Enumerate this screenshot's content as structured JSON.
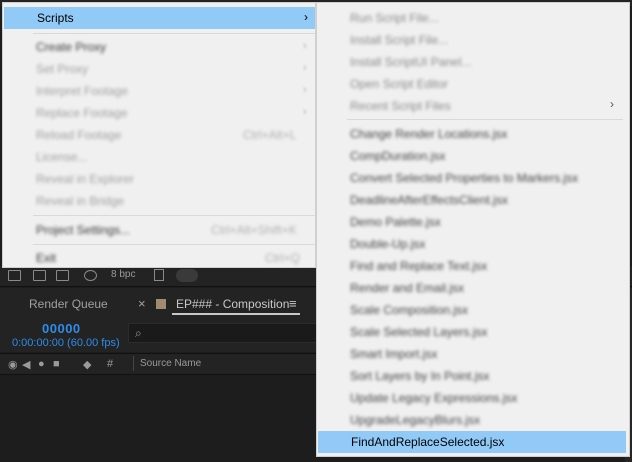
{
  "main_menu": {
    "scripts_label": "Scripts",
    "items": [
      {
        "label": "Create Proxy",
        "shortcut": ""
      },
      {
        "label": "Set Proxy",
        "shortcut": ""
      },
      {
        "label": "Interpret Footage",
        "shortcut": ""
      },
      {
        "label": "Replace Footage",
        "shortcut": ""
      },
      {
        "label": "Reload Footage",
        "shortcut": "Ctrl+Alt+L"
      },
      {
        "label": "License...",
        "shortcut": ""
      },
      {
        "label": "Reveal in Explorer",
        "shortcut": ""
      },
      {
        "label": "Reveal in Bridge",
        "shortcut": ""
      },
      {
        "label": "Project Settings...",
        "shortcut": "Ctrl+Alt+Shift+K"
      },
      {
        "label": "Exit",
        "shortcut": "Ctrl+Q"
      }
    ]
  },
  "scripts_submenu": {
    "commands": [
      "Run Script File...",
      "Install Script File...",
      "Install ScriptUI Panel...",
      "Open Script Editor",
      "Recent Script Files"
    ],
    "scripts": [
      "Change Render Locations.jsx",
      "CompDuration.jsx",
      "Convert Selected Properties to Markers.jsx",
      "DeadlineAfterEffectsClient.jsx",
      "Demo Palette.jsx",
      "Double-Up.jsx",
      "Find and Replace Text.jsx",
      "Render and Email.jsx",
      "Scale Composition.jsx",
      "Scale Selected Layers.jsx",
      "Smart Import.jsx",
      "Sort Layers by In Point.jsx",
      "Update Legacy Expressions.jsx",
      "UpgradeLegacyBlurs.jsx"
    ],
    "highlighted": "FindAndReplaceSelected.jsx"
  },
  "toolbar": {
    "bpc": "8 bpc"
  },
  "panels": {
    "tab_render_queue": "Render Queue",
    "tab_close": "×",
    "tab_composition": "EP### - Composition",
    "tab_menu": "≡",
    "timecode": "00000",
    "timecode_sub": "0:00:00:00 (60.00 fps)",
    "search_glyph": "⌕",
    "col_hash": "#",
    "col_source": "Source Name"
  },
  "colors": {
    "highlight": "#91c9f7",
    "menu_bg": "#f0f0f0",
    "timecode": "#2d8ceb",
    "panel_bg": "#1d1d1d"
  },
  "icons": [
    "chevron-right-icon",
    "search-icon",
    "eye-icon",
    "audio-icon",
    "solo-icon",
    "lock-icon",
    "label-icon",
    "trash-icon"
  ]
}
